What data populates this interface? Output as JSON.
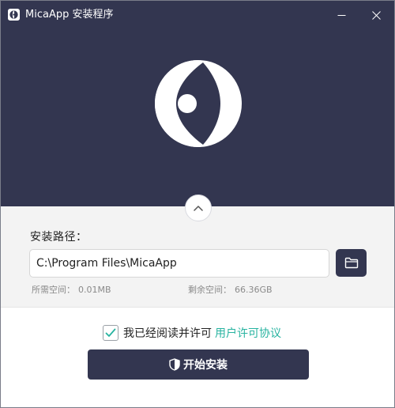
{
  "window": {
    "title": "MicaApp 安装程序"
  },
  "controls": {
    "minimize_icon": "minimize-icon",
    "close_icon": "close-icon"
  },
  "install": {
    "path_label": "安装路径：",
    "path_value": "C:\\Program Files\\MicaApp",
    "required_label": "所需空间：",
    "required_value": "0.01MB",
    "remaining_label": "剩余空间：",
    "remaining_value": "66.36GB",
    "browse_icon": "folder-icon"
  },
  "footer": {
    "agree_text": "我已经阅读并许可",
    "license_link": "用户许可协议",
    "agree_checked": true,
    "install_button": "开始安装"
  },
  "colors": {
    "dark": "#333650",
    "accent": "#27b3a0"
  }
}
